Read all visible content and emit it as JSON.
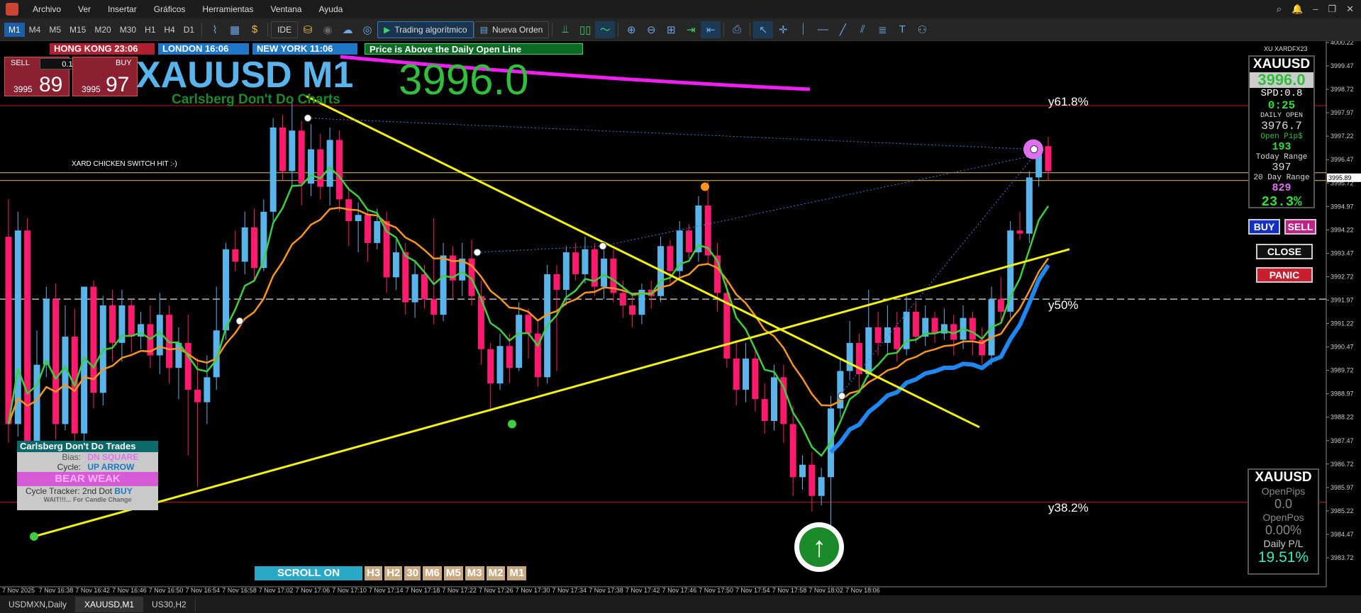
{
  "menu": [
    "Archivo",
    "Ver",
    "Insertar",
    "Gráficos",
    "Herramientas",
    "Ventana",
    "Ayuda"
  ],
  "toolbar": {
    "timeframes": [
      "M1",
      "M4",
      "M5",
      "M15",
      "M20",
      "M30",
      "H1",
      "H4",
      "D1"
    ],
    "active_timeframe": "M1",
    "ide_label": "IDE",
    "algo_label": "Trading algorítmico",
    "new_order_label": "Nueva Orden"
  },
  "sessions": [
    {
      "label": "HONG KONG 23:06",
      "color": "#b02030"
    },
    {
      "label": "LONDON 16:06",
      "color": "#1f77c8"
    },
    {
      "label": "NEW YORK 11:06",
      "color": "#1f77c8"
    }
  ],
  "price_status": "Price is Above the Daily Open Line",
  "trade_panel": {
    "sell_label": "SELL",
    "buy_label": "BUY",
    "lot": "0.10",
    "sell_prefix": "3995",
    "sell_big": "89",
    "buy_prefix": "3995",
    "buy_big": "97"
  },
  "title": {
    "symbol_tf": "XAUUSD M1",
    "subtitle": "Carlsberg Don't Do Charts",
    "price_big": "3996.0",
    "switch_note": "XARD CHICKEN SWITCH HIT :-)"
  },
  "fib": {
    "top": "y61.8%",
    "mid": "y50%",
    "low": "y38.2%"
  },
  "info_panel": {
    "broker": "XU XARDFX23",
    "symbol": "XAUUSD",
    "price": "3996.0",
    "spread": "SPD:0.8",
    "timer": "0:25",
    "daily_open_label": "DAILY OPEN",
    "daily_open": "3976.7",
    "open_pips_label": "Open Pip$",
    "open_pips": "193",
    "today_range_label": "Today Range",
    "today_range": "397",
    "day20_label": "20 Day Range",
    "day20": "829",
    "percent": "23.3%"
  },
  "buttons": {
    "buy": "BUY",
    "sell": "SELL",
    "close": "CLOSE",
    "panic": "PANIC"
  },
  "cdt": {
    "title": "Carlsberg Don't Do Trades",
    "bias_label": "Bias:",
    "bias_value": "DN SQUARE",
    "cycle_label": "Cycle:",
    "cycle_value": "UP ARROW",
    "bear": "BEAR WEAK",
    "tracker_label": "Cycle Tracker: 2nd Dot",
    "tracker_value": "BUY",
    "wait": "WAIT!!!... For Candle Change"
  },
  "bottom_panel": {
    "symbol": "XAUUSD",
    "open_pips_label": "OpenPips",
    "open_pips": "0.0",
    "open_pos_label": "OpenPos",
    "open_pos": "0.00%",
    "daily_pl_label": "Daily P/L",
    "daily_pl": "19.51%"
  },
  "scroll": {
    "label": "SCROLL ON",
    "timeframes": [
      "H3",
      "H2",
      "30",
      "M6",
      "M5",
      "M3",
      "M2",
      "M1"
    ]
  },
  "price_axis": [
    "4000.22",
    "3999.47",
    "3998.72",
    "3997.97",
    "3997.22",
    "3996.47",
    "3995.72",
    "3994.97",
    "3994.22",
    "3993.47",
    "3992.72",
    "3991.97",
    "3991.22",
    "3990.47",
    "3989.72",
    "3988.97",
    "3988.22",
    "3987.47",
    "3986.72",
    "3985.97",
    "3985.22",
    "3984.47",
    "3983.72"
  ],
  "current_price_tag": "3995.89",
  "time_axis": [
    "7 Nov 2025",
    "7 Nov 16:38",
    "7 Nov 16:42",
    "7 Nov 16:46",
    "7 Nov 16:50",
    "7 Nov 16:54",
    "7 Nov 16:58",
    "7 Nov 17:02",
    "7 Nov 17:06",
    "7 Nov 17:10",
    "7 Nov 17:14",
    "7 Nov 17:18",
    "7 Nov 17:22",
    "7 Nov 17:26",
    "7 Nov 17:30",
    "7 Nov 17:34",
    "7 Nov 17:38",
    "7 Nov 17:42",
    "7 Nov 17:46",
    "7 Nov 17:50",
    "7 Nov 17:54",
    "7 Nov 17:58",
    "7 Nov 18:02",
    "7 Nov 18:06"
  ],
  "tabs": [
    "USDMXN,Daily",
    "XAUUSD,M1",
    "US30,H2"
  ],
  "active_tab": "XAUUSD,M1",
  "candles": [
    [
      3994.0,
      3988.0,
      3995.2,
      3987.4
    ],
    [
      3988.0,
      3994.2,
      3994.8,
      3987.6
    ],
    [
      3994.2,
      3987.0,
      3994.6,
      3986.0
    ],
    [
      3987.0,
      3989.9,
      3991.0,
      3986.3
    ],
    [
      3989.9,
      3992.0,
      3992.4,
      3989.5
    ],
    [
      3992.0,
      3988.0,
      3992.5,
      3987.5
    ],
    [
      3988.0,
      3990.8,
      3991.8,
      3987.8
    ],
    [
      3990.8,
      3987.7,
      3991.7,
      3986.8
    ],
    [
      3987.7,
      3992.4,
      3992.4,
      3987.0
    ],
    [
      3992.4,
      3989.0,
      3992.6,
      3988.5
    ],
    [
      3989.0,
      3991.8,
      3992.1,
      3988.6
    ],
    [
      3991.8,
      3990.6,
      3992.3,
      3990.0
    ],
    [
      3990.6,
      3991.8,
      3992.3,
      3990.0
    ],
    [
      3991.8,
      3990.8,
      3992.0,
      3990.3
    ],
    [
      3990.8,
      3991.2,
      3991.6,
      3990.4
    ],
    [
      3991.2,
      3990.2,
      3991.8,
      3989.8
    ],
    [
      3990.2,
      3991.5,
      3992.2,
      3989.6
    ],
    [
      3991.5,
      3989.8,
      3991.8,
      3989.3
    ],
    [
      3989.8,
      3990.6,
      3991.1,
      3988.8
    ],
    [
      3990.6,
      3989.1,
      3991.5,
      3987.0
    ],
    [
      3989.1,
      3988.7,
      3990.1,
      3986.0
    ],
    [
      3988.7,
      3989.5,
      3990.2,
      3988.0
    ],
    [
      3989.5,
      3991.0,
      3992.4,
      3989.1
    ],
    [
      3991.0,
      3993.6,
      3993.8,
      3990.7
    ],
    [
      3993.6,
      3993.2,
      3994.2,
      3992.9
    ],
    [
      3993.2,
      3994.3,
      3994.8,
      3992.8
    ],
    [
      3994.3,
      3993.0,
      3994.9,
      3992.6
    ],
    [
      3993.0,
      3994.8,
      3995.2,
      3992.9
    ],
    [
      3994.8,
      3997.5,
      3997.8,
      3994.5
    ],
    [
      3997.5,
      3996.1,
      3997.9,
      3995.8
    ],
    [
      3996.1,
      3997.4,
      3998.3,
      3995.6
    ],
    [
      3997.4,
      3995.7,
      3997.7,
      3995.0
    ],
    [
      3995.7,
      3996.8,
      3997.6,
      3995.3
    ],
    [
      3996.8,
      3995.6,
      3997.3,
      3995.2
    ],
    [
      3995.6,
      3997.1,
      3997.5,
      3995.0
    ],
    [
      3997.1,
      3995.2,
      3997.4,
      3994.8
    ],
    [
      3995.2,
      3994.5,
      3995.6,
      3993.7
    ],
    [
      3994.5,
      3994.7,
      3995.1,
      3993.5
    ],
    [
      3994.7,
      3993.8,
      3994.9,
      3993.2
    ],
    [
      3993.8,
      3994.5,
      3994.9,
      3993.6
    ],
    [
      3994.5,
      3992.7,
      3994.8,
      3992.2
    ],
    [
      3992.7,
      3993.5,
      3993.9,
      3992.3
    ],
    [
      3993.5,
      3991.9,
      3993.8,
      3991.5
    ],
    [
      3991.9,
      3992.8,
      3993.2,
      3991.4
    ],
    [
      3992.8,
      3992.0,
      3993.1,
      3991.7
    ],
    [
      3992.0,
      3991.5,
      3994.6,
      3991.2
    ],
    [
      3991.5,
      3993.4,
      3993.8,
      3991.3
    ],
    [
      3993.4,
      3992.6,
      3993.7,
      3992.0
    ],
    [
      3992.6,
      3993.3,
      3993.8,
      3992.1
    ],
    [
      3993.3,
      3992.1,
      3993.9,
      3991.8
    ],
    [
      3992.1,
      3990.4,
      3992.6,
      3989.9
    ],
    [
      3990.4,
      3989.3,
      3990.6,
      3988.4
    ],
    [
      3989.3,
      3990.5,
      3990.9,
      3989.1
    ],
    [
      3990.5,
      3989.8,
      3990.9,
      3989.3
    ],
    [
      3989.8,
      3991.5,
      3991.9,
      3989.7
    ],
    [
      3991.5,
      3990.9,
      3991.7,
      3990.1
    ],
    [
      3990.9,
      3989.5,
      3991.3,
      3989.2
    ],
    [
      3989.5,
      3992.8,
      3993.1,
      3989.3
    ],
    [
      3992.8,
      3992.3,
      3993.1,
      3989.7
    ],
    [
      3992.3,
      3993.5,
      3993.7,
      3991.8
    ],
    [
      3993.5,
      3992.8,
      3993.8,
      3992.6
    ],
    [
      3992.8,
      3993.6,
      3994.0,
      3992.5
    ],
    [
      3993.6,
      3992.4,
      3993.8,
      3992.1
    ],
    [
      3992.4,
      3993.3,
      3993.6,
      3992.0
    ],
    [
      3993.3,
      3992.2,
      3993.6,
      3991.9
    ],
    [
      3992.2,
      3991.8,
      3992.6,
      3991.4
    ],
    [
      3991.8,
      3991.5,
      3992.1,
      3991.1
    ],
    [
      3991.5,
      3992.3,
      3992.5,
      3991.2
    ],
    [
      3992.3,
      3992.1,
      3992.6,
      3991.7
    ],
    [
      3992.1,
      3993.7,
      3994.0,
      3991.9
    ],
    [
      3993.7,
      3992.9,
      3993.9,
      3992.5
    ],
    [
      3992.9,
      3994.2,
      3994.5,
      3992.6
    ],
    [
      3994.2,
      3993.5,
      3994.4,
      3993.3
    ],
    [
      3993.5,
      3995.0,
      3995.3,
      3993.2
    ],
    [
      3995.0,
      3993.4,
      3995.8,
      3993.1
    ],
    [
      3993.4,
      3992.2,
      3993.8,
      3991.6
    ],
    [
      3992.2,
      3990.1,
      3992.6,
      3989.8
    ],
    [
      3990.1,
      3989.1,
      3990.7,
      3988.6
    ],
    [
      3989.1,
      3990.1,
      3990.6,
      3988.7
    ],
    [
      3990.1,
      3988.8,
      3990.4,
      3988.4
    ],
    [
      3988.8,
      3988.1,
      3989.3,
      3987.7
    ],
    [
      3988.1,
      3989.5,
      3989.9,
      3987.8
    ],
    [
      3989.5,
      3988.0,
      3989.9,
      3987.4
    ],
    [
      3988.0,
      3986.3,
      3988.6,
      3985.7
    ],
    [
      3986.3,
      3986.7,
      3987.0,
      3985.9
    ],
    [
      3986.7,
      3985.7,
      3987.1,
      3985.2
    ],
    [
      3985.7,
      3986.3,
      3986.6,
      3985.4
    ],
    [
      3986.3,
      3988.5,
      3988.9,
      3984.7
    ],
    [
      3988.5,
      3989.7,
      3990.1,
      3988.2
    ],
    [
      3989.7,
      3990.6,
      3991.3,
      3989.4
    ],
    [
      3990.6,
      3989.6,
      3990.9,
      3989.0
    ],
    [
      3989.6,
      3991.1,
      3992.3,
      3989.5
    ],
    [
      3991.1,
      3990.6,
      3991.6,
      3990.2
    ],
    [
      3990.6,
      3991.1,
      3991.8,
      3990.2
    ],
    [
      3991.1,
      3990.4,
      3991.6,
      3990.0
    ],
    [
      3990.4,
      3991.6,
      3992.1,
      3990.2
    ],
    [
      3991.6,
      3990.8,
      3991.9,
      3990.6
    ],
    [
      3990.8,
      3991.4,
      3991.8,
      3990.5
    ],
    [
      3991.4,
      3990.9,
      3991.6,
      3990.6
    ],
    [
      3990.9,
      3991.2,
      3991.7,
      3990.7
    ],
    [
      3991.2,
      3990.7,
      3991.5,
      3990.2
    ],
    [
      3990.7,
      3991.4,
      3991.8,
      3990.4
    ],
    [
      3991.4,
      3990.7,
      3991.6,
      3990.2
    ],
    [
      3990.7,
      3990.2,
      3991.1,
      3989.9
    ],
    [
      3990.2,
      3992.0,
      3992.4,
      3989.9
    ],
    [
      3992.0,
      3991.6,
      3992.7,
      3991.3
    ],
    [
      3991.6,
      3994.2,
      3994.5,
      3991.4
    ],
    [
      3994.2,
      3994.1,
      3994.8,
      3993.9
    ],
    [
      3994.1,
      3995.9,
      3996.1,
      3993.8
    ],
    [
      3995.9,
      3996.9,
      3997.0,
      3995.6
    ],
    [
      3996.9,
      3996.1,
      3997.2,
      3995.8
    ]
  ],
  "colors": {
    "bull": "#5ab4ec",
    "bear": "#ff1a6e",
    "ema_fast": "#3dcf3d",
    "ema_slow": "#f7951e",
    "trend": "#f2f20a",
    "magenta": "#f01ef0",
    "blue_band": "#1e88f0"
  }
}
